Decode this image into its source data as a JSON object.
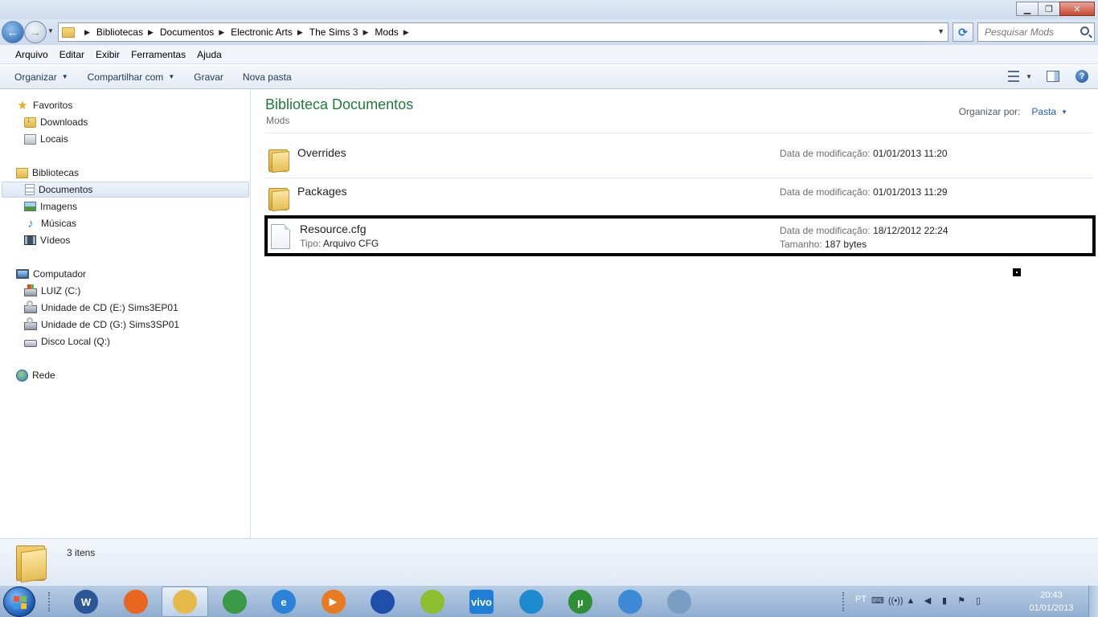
{
  "window": {
    "caption": {
      "minimize": "▁",
      "maximize": "❐",
      "close": "✕"
    }
  },
  "address": {
    "crumbs": [
      "Bibliotecas",
      "Documentos",
      "Electronic Arts",
      "The Sims 3",
      "Mods"
    ],
    "search_placeholder": "Pesquisar Mods"
  },
  "menu": [
    "Arquivo",
    "Editar",
    "Exibir",
    "Ferramentas",
    "Ajuda"
  ],
  "commands": {
    "organize": "Organizar",
    "share": "Compartilhar com",
    "burn": "Gravar",
    "new_folder": "Nova pasta"
  },
  "sidebar": {
    "favorites": {
      "label": "Favoritos",
      "items": [
        {
          "label": "Downloads",
          "icon": "downloads-folder-icon"
        },
        {
          "label": "Locais",
          "icon": "recent-places-icon"
        }
      ]
    },
    "libraries": {
      "label": "Bibliotecas",
      "items": [
        {
          "label": "Documentos",
          "icon": "documents-icon",
          "selected": true
        },
        {
          "label": "Imagens",
          "icon": "pictures-icon"
        },
        {
          "label": "Músicas",
          "icon": "music-icon"
        },
        {
          "label": "Vídeos",
          "icon": "videos-icon"
        }
      ]
    },
    "computer": {
      "label": "Computador",
      "items": [
        {
          "label": "LUIZ (C:)",
          "icon": "windows-drive-icon"
        },
        {
          "label": "Unidade de CD (E:) Sims3EP01",
          "icon": "cd-drive-icon"
        },
        {
          "label": "Unidade de CD (G:) Sims3SP01",
          "icon": "cd-drive-icon"
        },
        {
          "label": "Disco Local (Q:)",
          "icon": "hard-drive-icon"
        }
      ]
    },
    "network": {
      "label": "Rede",
      "icon": "network-icon"
    }
  },
  "main": {
    "title": "Biblioteca Documentos",
    "subtitle": "Mods",
    "arrange_label": "Organizar por:",
    "arrange_value": "Pasta",
    "files": [
      {
        "name": "Overrides",
        "kind": "folder",
        "modified_label": "Data de modificação:",
        "modified": "01/01/2013 11:20"
      },
      {
        "name": "Packages",
        "kind": "folder",
        "modified_label": "Data de modificação:",
        "modified": "01/01/2013 11:29"
      },
      {
        "name": "Resource.cfg",
        "kind": "file",
        "type_label": "Tipo:",
        "type": "Arquivo CFG",
        "modified_label": "Data de modificação:",
        "modified": "18/12/2012 22:24",
        "size_label": "Tamanho:",
        "size": "187 bytes"
      }
    ]
  },
  "details": {
    "count": "3 itens"
  },
  "taskbar": {
    "apps": [
      {
        "name": "word",
        "glyph": "W",
        "color": "#2b5797"
      },
      {
        "name": "firefox",
        "glyph": "",
        "color": "#e8661e"
      },
      {
        "name": "explorer",
        "glyph": "",
        "color": "#e6b94b",
        "active": true
      },
      {
        "name": "chrome",
        "glyph": "",
        "color": "#3a9a45"
      },
      {
        "name": "internet-explorer",
        "glyph": "e",
        "color": "#2c83d6"
      },
      {
        "name": "media-player",
        "glyph": "▶",
        "color": "#e97a1f"
      },
      {
        "name": "sims-globe",
        "glyph": "",
        "color": "#1f4fa8"
      },
      {
        "name": "sims-3",
        "glyph": "",
        "color": "#8cbf2e"
      },
      {
        "name": "vivo",
        "glyph": "vivo",
        "color": "#1f7fd6"
      },
      {
        "name": "sims-launcher",
        "glyph": "",
        "color": "#1e8bcf"
      },
      {
        "name": "utorrent",
        "glyph": "µ",
        "color": "#2e8f36"
      },
      {
        "name": "messenger",
        "glyph": "",
        "color": "#3e89d6"
      },
      {
        "name": "paint",
        "glyph": "",
        "color": "#7a9dc4"
      }
    ],
    "tray": {
      "lang": "PT",
      "time": "20:43",
      "date": "01/01/2013"
    }
  }
}
